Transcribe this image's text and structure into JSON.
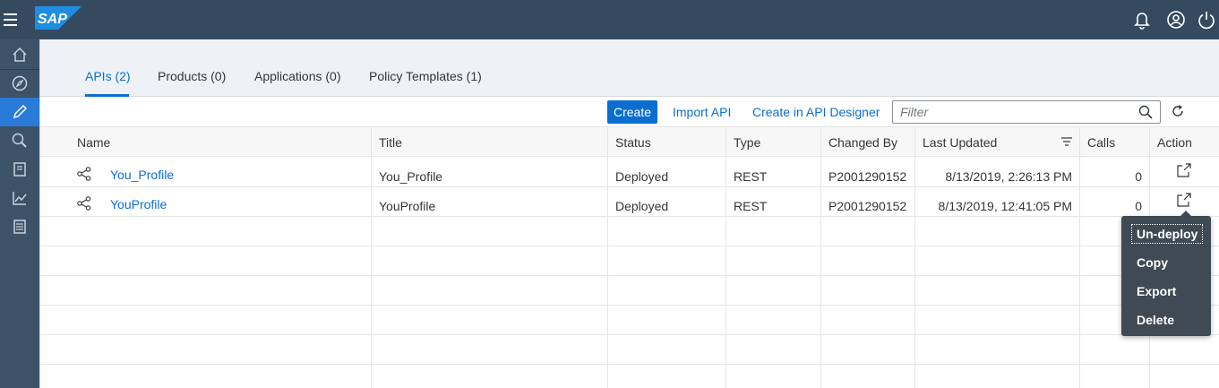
{
  "shell": {
    "logo_text": "SAP",
    "icons": [
      "menu-icon",
      "bell-icon",
      "user-icon",
      "power-icon"
    ]
  },
  "sidenav": {
    "items": [
      "home-icon",
      "discover-icon",
      "develop-icon",
      "test-icon",
      "configure-icon",
      "analyze-icon",
      "report-icon"
    ],
    "active_index": 2
  },
  "tabs": [
    {
      "label": "APIs (2)",
      "active": true
    },
    {
      "label": "Products (0)",
      "active": false
    },
    {
      "label": "Applications (0)",
      "active": false
    },
    {
      "label": "Policy Templates (1)",
      "active": false
    }
  ],
  "toolbar": {
    "create_label": "Create",
    "import_label": "Import API",
    "designer_label": "Create in API Designer",
    "filter_placeholder": "Filter"
  },
  "table": {
    "columns": [
      "Name",
      "Title",
      "Status",
      "Type",
      "Changed By",
      "Last Updated",
      "Calls",
      "Action"
    ],
    "rows": [
      {
        "name": "You_Profile",
        "title": "You_Profile",
        "status": "Deployed",
        "type": "REST",
        "changed_by": "P2001290152",
        "last_updated": "8/13/2019, 2:26:13 PM",
        "calls": "0"
      },
      {
        "name": "YouProfile",
        "title": "YouProfile",
        "status": "Deployed",
        "type": "REST",
        "changed_by": "P2001290152",
        "last_updated": "8/13/2019, 12:41:05 PM",
        "calls": "0"
      }
    ]
  },
  "action_menu": {
    "items": [
      "Un-deploy",
      "Copy",
      "Export",
      "Delete"
    ]
  },
  "colors": {
    "shell": "#354a5f",
    "sidenav": "#3c5367",
    "accent": "#0a6ed1",
    "menu_bg": "#3f4a55"
  }
}
